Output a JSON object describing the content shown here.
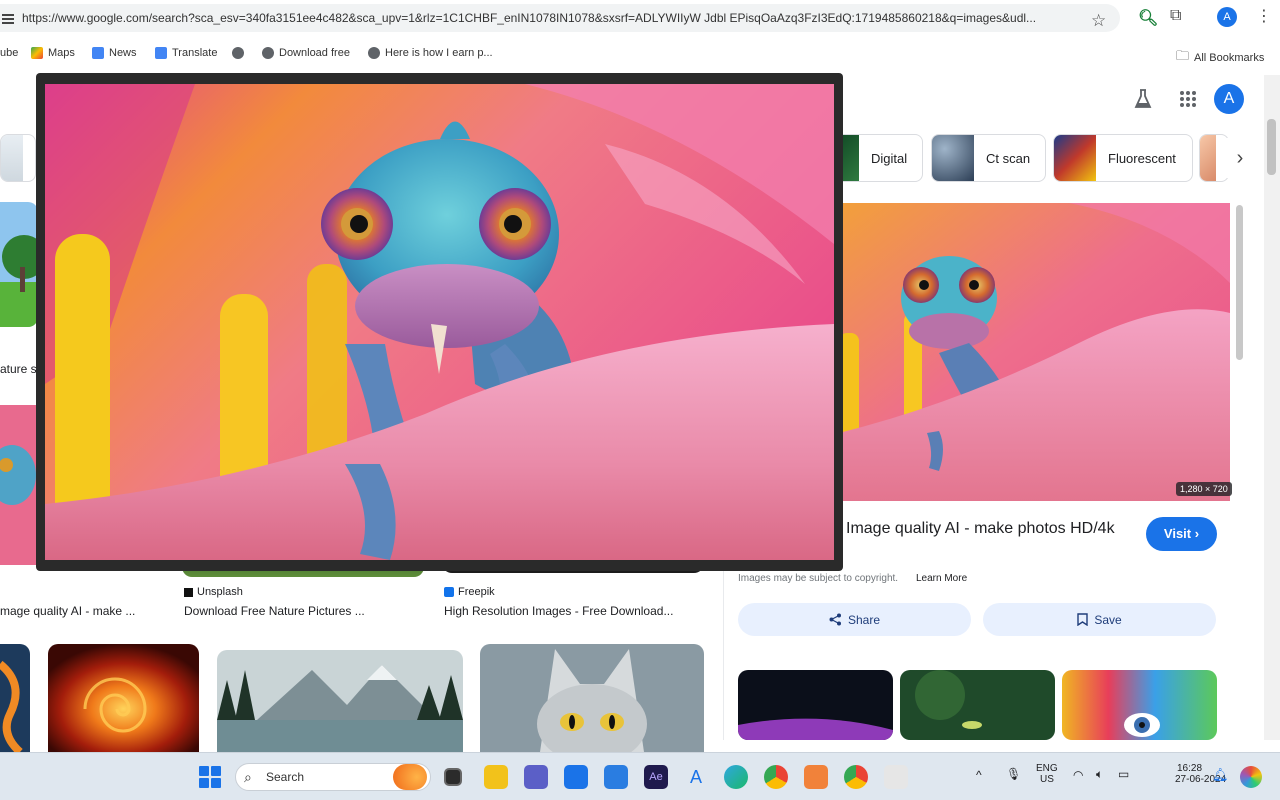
{
  "browser": {
    "url": "https://www.google.com/search?sca_esv=340fa3151ee4c482&sca_upv=1&rlz=1C1CHBF_enIN1078IN1078&sxsrf=ADLYWIIyW Jdbl EPisqOaAzq3FzI3EdQ:1719485860218&q=images&udl...",
    "all_bookmarks": "All Bookmarks",
    "avatar_letter": "A"
  },
  "bookmarks": [
    {
      "label": "ube"
    },
    {
      "label": "Maps"
    },
    {
      "label": "News"
    },
    {
      "label": "Translate"
    },
    {
      "label": ""
    },
    {
      "label": "Download free"
    },
    {
      "label": "Here is how I earn p..."
    }
  ],
  "google": {
    "avatar_letter": "A"
  },
  "chips": [
    {
      "label": "Digital"
    },
    {
      "label": "Ct scan"
    },
    {
      "label": "Fluorescent"
    }
  ],
  "side_panel": {
    "dimensions": "1,280 × 720",
    "title": "Image quality AI - make photos HD/4k",
    "visit": "Visit",
    "copyright": "Images may be subject to copyright.",
    "learn_more": "Learn More",
    "share": "Share",
    "save": "Save"
  },
  "results": {
    "left_partial_caption": "ature s",
    "left_title": "mage quality AI - make ...",
    "result2_source": "Unsplash",
    "result2_title": "Download Free Nature Pictures ...",
    "result3_source": "Freepik",
    "result3_title": "High Resolution Images - Free Download..."
  },
  "taskbar": {
    "search": "Search",
    "lang_line1": "ENG",
    "lang_line2": "US",
    "time": "16:28",
    "date": "27-06-2024"
  },
  "colors": {
    "accent": "#1a73e8",
    "pill_bg": "#e8f0fe"
  }
}
